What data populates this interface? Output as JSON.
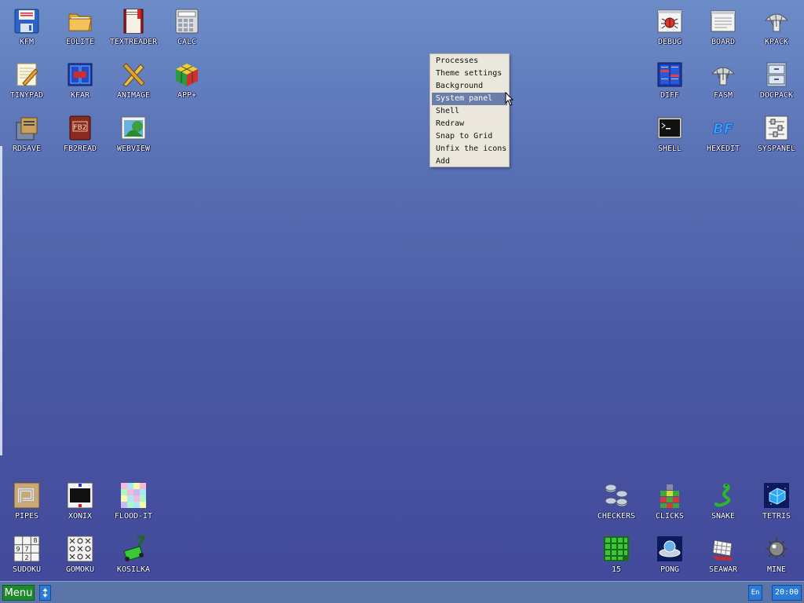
{
  "desktop": {
    "icons_top_left": [
      {
        "label": "KFM",
        "icon": "floppy-disk-icon"
      },
      {
        "label": "EOLITE",
        "icon": "folder-icon"
      },
      {
        "label": "TEXTREADER",
        "icon": "book-icon"
      },
      {
        "label": "CALC",
        "icon": "calculator-icon"
      },
      {
        "label": "TINYPAD",
        "icon": "notepad-icon"
      },
      {
        "label": "KFAR",
        "icon": "file-manager-icon"
      },
      {
        "label": "ANIMAGE",
        "icon": "pencil-ruler-icon"
      },
      {
        "label": "APP+",
        "icon": "cube-icon"
      },
      {
        "label": "RDSAVE",
        "icon": "save-icon"
      },
      {
        "label": "FB2READ",
        "icon": "fb2-book-icon"
      },
      {
        "label": "WEBVIEW",
        "icon": "browser-globe-icon"
      }
    ],
    "icons_top_right": [
      {
        "label": "DEBUG",
        "icon": "bug-icon"
      },
      {
        "label": "BOARD",
        "icon": "clipboard-window-icon"
      },
      {
        "label": "KPACK",
        "icon": "mushroom-icon"
      },
      {
        "label": "DIFF",
        "icon": "diff-icon"
      },
      {
        "label": "FASM",
        "icon": "assembler-icon"
      },
      {
        "label": "DOCPACK",
        "icon": "cabinet-icon"
      },
      {
        "label": "SHELL",
        "icon": "terminal-icon"
      },
      {
        "label": "HEXEDIT",
        "icon": "hexedit-icon",
        "text": "BF"
      },
      {
        "label": "SYSPANEL",
        "icon": "sliders-icon"
      }
    ],
    "icons_bottom_left": [
      {
        "label": "PIPES",
        "icon": "pipes-icon"
      },
      {
        "label": "XONIX",
        "icon": "xonix-icon"
      },
      {
        "label": "FLOOD-IT",
        "icon": "flood-it-icon"
      },
      {
        "label": "SUDOKU",
        "icon": "sudoku-icon"
      },
      {
        "label": "GOMOKU",
        "icon": "gomoku-icon"
      },
      {
        "label": "KOSILKA",
        "icon": "lawnmower-icon"
      }
    ],
    "icons_bottom_right": [
      {
        "label": "CHECKERS",
        "icon": "checkers-icon"
      },
      {
        "label": "CLICKS",
        "icon": "clicks-icon"
      },
      {
        "label": "SNAKE",
        "icon": "snake-icon"
      },
      {
        "label": "TETRIS",
        "icon": "tetris-icon"
      },
      {
        "label": "15",
        "icon": "fifteen-puzzle-icon"
      },
      {
        "label": "PONG",
        "icon": "pong-icon"
      },
      {
        "label": "SEAWAR",
        "icon": "seawar-icon"
      },
      {
        "label": "MINE",
        "icon": "mine-icon"
      }
    ]
  },
  "context_menu": {
    "items": [
      "Processes",
      "Theme settings",
      "Background",
      "System panel",
      "Shell",
      "Redraw",
      "Snap to Grid",
      "Unfix the icons",
      "Add"
    ],
    "selected": "System panel"
  },
  "taskbar": {
    "menu_label": "Menu",
    "language": "En",
    "clock": "20:00"
  },
  "colors": {
    "menu_button": "#1f8a2c",
    "taskbar": "#5a74a8",
    "highlight": "#6b7ea8"
  }
}
